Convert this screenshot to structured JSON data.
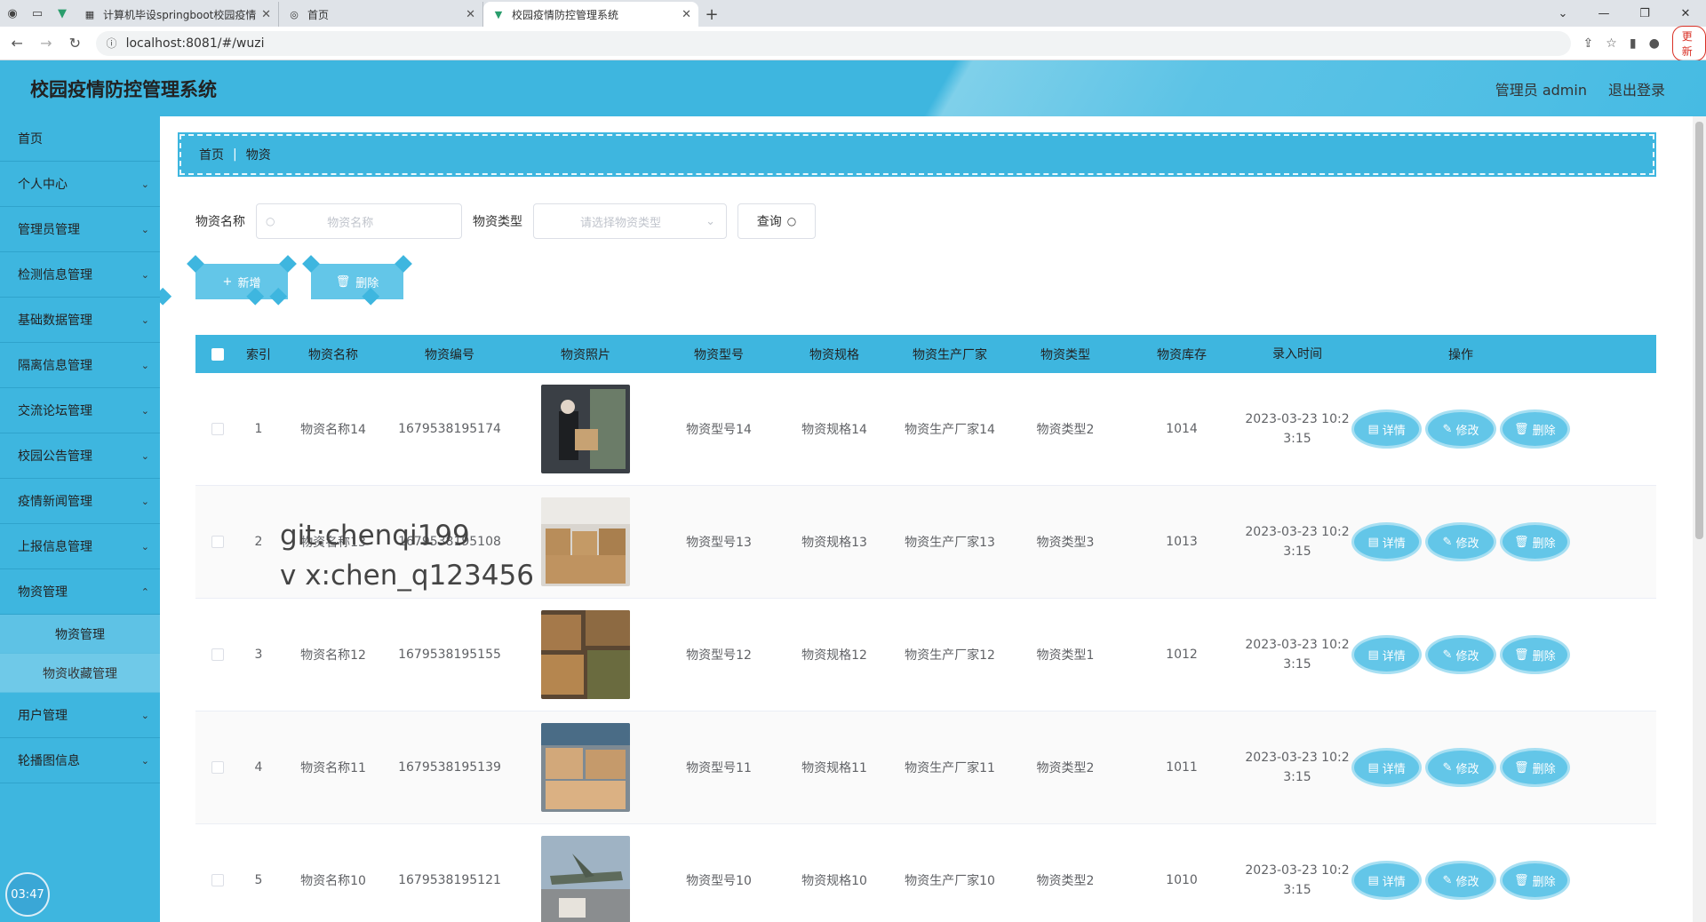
{
  "browser": {
    "tabs": [
      {
        "title": "计算机毕设springboot校园疫情",
        "icon": "calendar-icon"
      },
      {
        "title": "首页",
        "icon": "globe-icon"
      },
      {
        "title": "校园疫情防控管理系统",
        "icon": "vue-icon"
      }
    ],
    "url": "localhost:8081/#/wuzi",
    "update_label": "更新"
  },
  "header": {
    "title": "校园疫情防控管理系统",
    "user": "管理员 admin",
    "logout": "退出登录"
  },
  "sidebar": {
    "items": [
      {
        "label": "首页"
      },
      {
        "label": "个人中心"
      },
      {
        "label": "管理员管理"
      },
      {
        "label": "检测信息管理"
      },
      {
        "label": "基础数据管理"
      },
      {
        "label": "隔离信息管理"
      },
      {
        "label": "交流论坛管理"
      },
      {
        "label": "校园公告管理"
      },
      {
        "label": "疫情新闻管理"
      },
      {
        "label": "上报信息管理"
      },
      {
        "label": "物资管理"
      }
    ],
    "submenu": [
      {
        "label": "物资管理"
      },
      {
        "label": "物资收藏管理"
      }
    ],
    "items_after": [
      {
        "label": "用户管理"
      },
      {
        "label": "轮播图信息"
      }
    ],
    "clock": "03:47"
  },
  "breadcrumb": {
    "home": "首页",
    "current": "物资"
  },
  "search": {
    "name_label": "物资名称",
    "name_placeholder": "物资名称",
    "type_label": "物资类型",
    "type_placeholder": "请选择物资类型",
    "query_label": "查询"
  },
  "actions": {
    "add_label": "新增",
    "delete_label": "删除"
  },
  "table": {
    "headers": {
      "index": "索引",
      "name": "物资名称",
      "code": "物资编号",
      "photo": "物资照片",
      "model": "物资型号",
      "spec": "物资规格",
      "mfr": "物资生产厂家",
      "type": "物资类型",
      "stock": "物资库存",
      "time": "录入时间",
      "ops": "操作"
    },
    "rows": [
      {
        "index": "1",
        "name": "物资名称14",
        "code": "1679538195174",
        "model": "物资型号14",
        "spec": "物资规格14",
        "mfr": "物资生产厂家14",
        "type": "物资类型2",
        "stock": "1014",
        "time_a": "2023-03-23 10:2",
        "time_b": "3:15"
      },
      {
        "index": "2",
        "name": "物资名称13",
        "code": "1679538195108",
        "model": "物资型号13",
        "spec": "物资规格13",
        "mfr": "物资生产厂家13",
        "type": "物资类型3",
        "stock": "1013",
        "time_a": "2023-03-23 10:2",
        "time_b": "3:15"
      },
      {
        "index": "3",
        "name": "物资名称12",
        "code": "1679538195155",
        "model": "物资型号12",
        "spec": "物资规格12",
        "mfr": "物资生产厂家12",
        "type": "物资类型1",
        "stock": "1012",
        "time_a": "2023-03-23 10:2",
        "time_b": "3:15"
      },
      {
        "index": "4",
        "name": "物资名称11",
        "code": "1679538195139",
        "model": "物资型号11",
        "spec": "物资规格11",
        "mfr": "物资生产厂家11",
        "type": "物资类型2",
        "stock": "1011",
        "time_a": "2023-03-23 10:2",
        "time_b": "3:15"
      },
      {
        "index": "5",
        "name": "物资名称10",
        "code": "1679538195121",
        "model": "物资型号10",
        "spec": "物资规格10",
        "mfr": "物资生产厂家10",
        "type": "物资类型2",
        "stock": "1010",
        "time_a": "2023-03-23 10:2",
        "time_b": "3:15"
      }
    ],
    "op_labels": {
      "detail": "详情",
      "edit": "修改",
      "delete": "删除"
    }
  },
  "watermark": {
    "line1": "git:chenqi199",
    "line2": "v x:chen_q123456"
  },
  "colors": {
    "accent": "#3eb6df",
    "button": "#63c6e8"
  }
}
